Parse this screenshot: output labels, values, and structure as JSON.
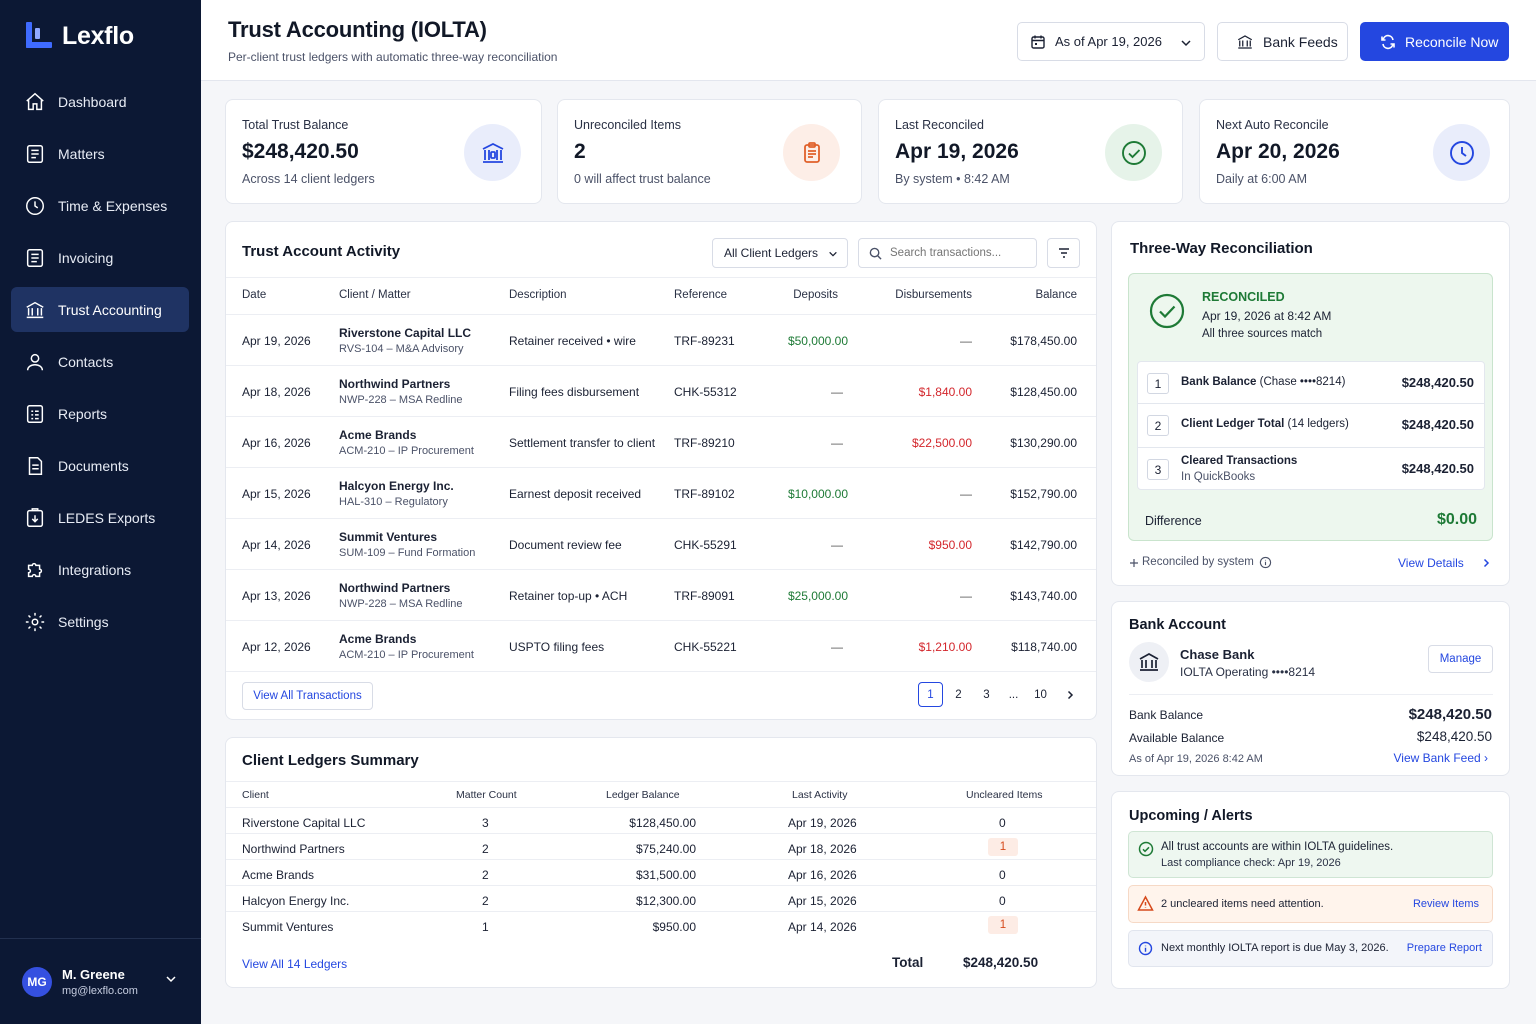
{
  "app": {
    "name": "Lexflo"
  },
  "nav": {
    "items": [
      {
        "label": "Dashboard",
        "icon": "home-icon"
      },
      {
        "label": "Matters",
        "icon": "document-icon"
      },
      {
        "label": "Time & Expenses",
        "icon": "clock-icon"
      },
      {
        "label": "Invoicing",
        "icon": "invoice-icon"
      },
      {
        "label": "Trust Accounting",
        "icon": "bank-icon",
        "active": true
      },
      {
        "label": "Contacts",
        "icon": "person-icon"
      },
      {
        "label": "Reports",
        "icon": "report-icon"
      },
      {
        "label": "Documents",
        "icon": "documents-icon"
      },
      {
        "label": "LEDES Exports",
        "icon": "export-icon"
      },
      {
        "label": "Integrations",
        "icon": "puzzle-icon"
      },
      {
        "label": "Settings",
        "icon": "gear-icon"
      }
    ]
  },
  "user": {
    "initials": "MG",
    "name": "M. Greene",
    "email": "mg@lexflo.com"
  },
  "header": {
    "title": "Trust Accounting (IOLTA)",
    "subtitle": "Per-client trust ledgers with automatic three-way reconciliation",
    "date_select": "As of Apr 19, 2026",
    "bank_feeds": "Bank Feeds",
    "reconcile_now": "Reconcile Now"
  },
  "stats": [
    {
      "label": "Total Trust Balance",
      "value": "$248,420.50",
      "sub": "Across 14 client ledgers",
      "icon": "bank-icon"
    },
    {
      "label": "Unreconciled Items",
      "value": "2",
      "sub": "0 will affect trust balance",
      "icon": "clipboard-icon"
    },
    {
      "label": "Last Reconciled",
      "value": "Apr 19, 2026",
      "sub": "By system • 8:42 AM",
      "icon": "check-circle-icon"
    },
    {
      "label": "Next Auto Reconcile",
      "value": "Apr 20, 2026",
      "sub": "Daily at 6:00 AM",
      "icon": "clock-icon"
    }
  ],
  "activity": {
    "title": "Trust Account Activity",
    "ledger_filter": "All Client Ledgers",
    "search_placeholder": "Search transactions...",
    "columns": [
      "Date",
      "Client / Matter",
      "Description",
      "Reference",
      "Deposits",
      "Disbursements",
      "Balance"
    ],
    "rows": [
      {
        "date": "Apr 19, 2026",
        "client": "Riverstone Capital LLC",
        "matter": "RVS-104 – M&A Advisory",
        "description": "Retainer received • wire",
        "reference": "TRF-89231",
        "deposit": "$50,000.00",
        "disbursement": "—",
        "balance": "$178,450.00"
      },
      {
        "date": "Apr 18, 2026",
        "client": "Northwind Partners",
        "matter": "NWP-228 – MSA Redline",
        "description": "Filing fees disbursement",
        "reference": "CHK-55312",
        "deposit": "—",
        "disbursement": "$1,840.00",
        "balance": "$128,450.00"
      },
      {
        "date": "Apr 16, 2026",
        "client": "Acme Brands",
        "matter": "ACM-210 – IP Procurement",
        "description": "Settlement transfer to client",
        "reference": "TRF-89210",
        "deposit": "—",
        "disbursement": "$22,500.00",
        "balance": "$130,290.00"
      },
      {
        "date": "Apr 15, 2026",
        "client": "Halcyon Energy Inc.",
        "matter": "HAL-310 – Regulatory",
        "description": "Earnest deposit received",
        "reference": "TRF-89102",
        "deposit": "$10,000.00",
        "disbursement": "—",
        "balance": "$152,790.00"
      },
      {
        "date": "Apr 14, 2026",
        "client": "Summit Ventures",
        "matter": "SUM-109 – Fund Formation",
        "description": "Document review fee",
        "reference": "CHK-55291",
        "deposit": "—",
        "disbursement": "$950.00",
        "balance": "$142,790.00"
      },
      {
        "date": "Apr 13, 2026",
        "client": "Northwind Partners",
        "matter": "NWP-228 – MSA Redline",
        "description": "Retainer top-up • ACH",
        "reference": "TRF-89091",
        "deposit": "$25,000.00",
        "disbursement": "—",
        "balance": "$143,740.00"
      },
      {
        "date": "Apr 12, 2026",
        "client": "Acme Brands",
        "matter": "ACM-210 – IP Procurement",
        "description": "USPTO filing fees",
        "reference": "CHK-55221",
        "deposit": "—",
        "disbursement": "$1,210.00",
        "balance": "$118,740.00"
      }
    ],
    "view_all": "View All Transactions",
    "pages": [
      "1",
      "2",
      "3",
      "...",
      "10"
    ],
    "current_page": "1"
  },
  "ledgers": {
    "title": "Client Ledgers Summary",
    "columns": [
      "Client",
      "Matter Count",
      "Ledger Balance",
      "Last Activity",
      "Uncleared Items"
    ],
    "rows": [
      {
        "client": "Riverstone Capital LLC",
        "count": "3",
        "balance": "$128,450.00",
        "last": "Apr 19, 2026",
        "uncleared": "0",
        "flag": false
      },
      {
        "client": "Northwind Partners",
        "count": "2",
        "balance": "$75,240.00",
        "last": "Apr 18, 2026",
        "uncleared": "1",
        "flag": true
      },
      {
        "client": "Acme Brands",
        "count": "2",
        "balance": "$31,500.00",
        "last": "Apr 16, 2026",
        "uncleared": "0",
        "flag": false
      },
      {
        "client": "Halcyon Energy Inc.",
        "count": "2",
        "balance": "$12,300.00",
        "last": "Apr 15, 2026",
        "uncleared": "0",
        "flag": false
      },
      {
        "client": "Summit Ventures",
        "count": "1",
        "balance": "$950.00",
        "last": "Apr 14, 2026",
        "uncleared": "1",
        "flag": true
      }
    ],
    "view_all": "View All 14 Ledgers",
    "total_label": "Total",
    "total_value": "$248,420.50"
  },
  "recon": {
    "title": "Three-Way Reconciliation",
    "status": "RECONCILED",
    "when": "Apr 19, 2026 at 8:42 AM",
    "note": "All three sources match",
    "items": [
      {
        "num": "1",
        "label": "Bank Balance",
        "detail": "(Chase ••••8214)",
        "value": "$248,420.50"
      },
      {
        "num": "2",
        "label": "Client Ledger Total",
        "detail": "(14 ledgers)",
        "value": "$248,420.50"
      },
      {
        "num": "3",
        "label": "Cleared Transactions",
        "detail": "In QuickBooks",
        "value": "$248,420.50"
      }
    ],
    "difference_label": "Difference",
    "difference_value": "$0.00",
    "footer": "Reconciled by system",
    "view_details": "View Details"
  },
  "bank": {
    "title": "Bank Account",
    "name": "Chase Bank",
    "account": "IOLTA Operating ••••8214",
    "manage": "Manage",
    "balance_label": "Bank Balance",
    "balance_value": "$248,420.50",
    "available_label": "Available Balance",
    "available_value": "$248,420.50",
    "as_of": "As of Apr 19, 2026 8:42 AM",
    "view_feed": "View Bank Feed ›"
  },
  "alerts": {
    "title": "Upcoming / Alerts",
    "items": [
      {
        "kind": "success",
        "text": "All trust accounts are within IOLTA guidelines.",
        "sub": "Last compliance check: Apr 19, 2026",
        "action": ""
      },
      {
        "kind": "warning",
        "text": "2 uncleared items need attention.",
        "sub": "",
        "action": "Review Items"
      },
      {
        "kind": "info",
        "text": "Next monthly IOLTA report is due May 3, 2026.",
        "sub": "",
        "action": "Prepare Report"
      }
    ]
  },
  "colors": {
    "sidebar": "#0c1834",
    "accent": "#2447e0",
    "positive": "#1e7a36",
    "negative": "#d3262c"
  }
}
